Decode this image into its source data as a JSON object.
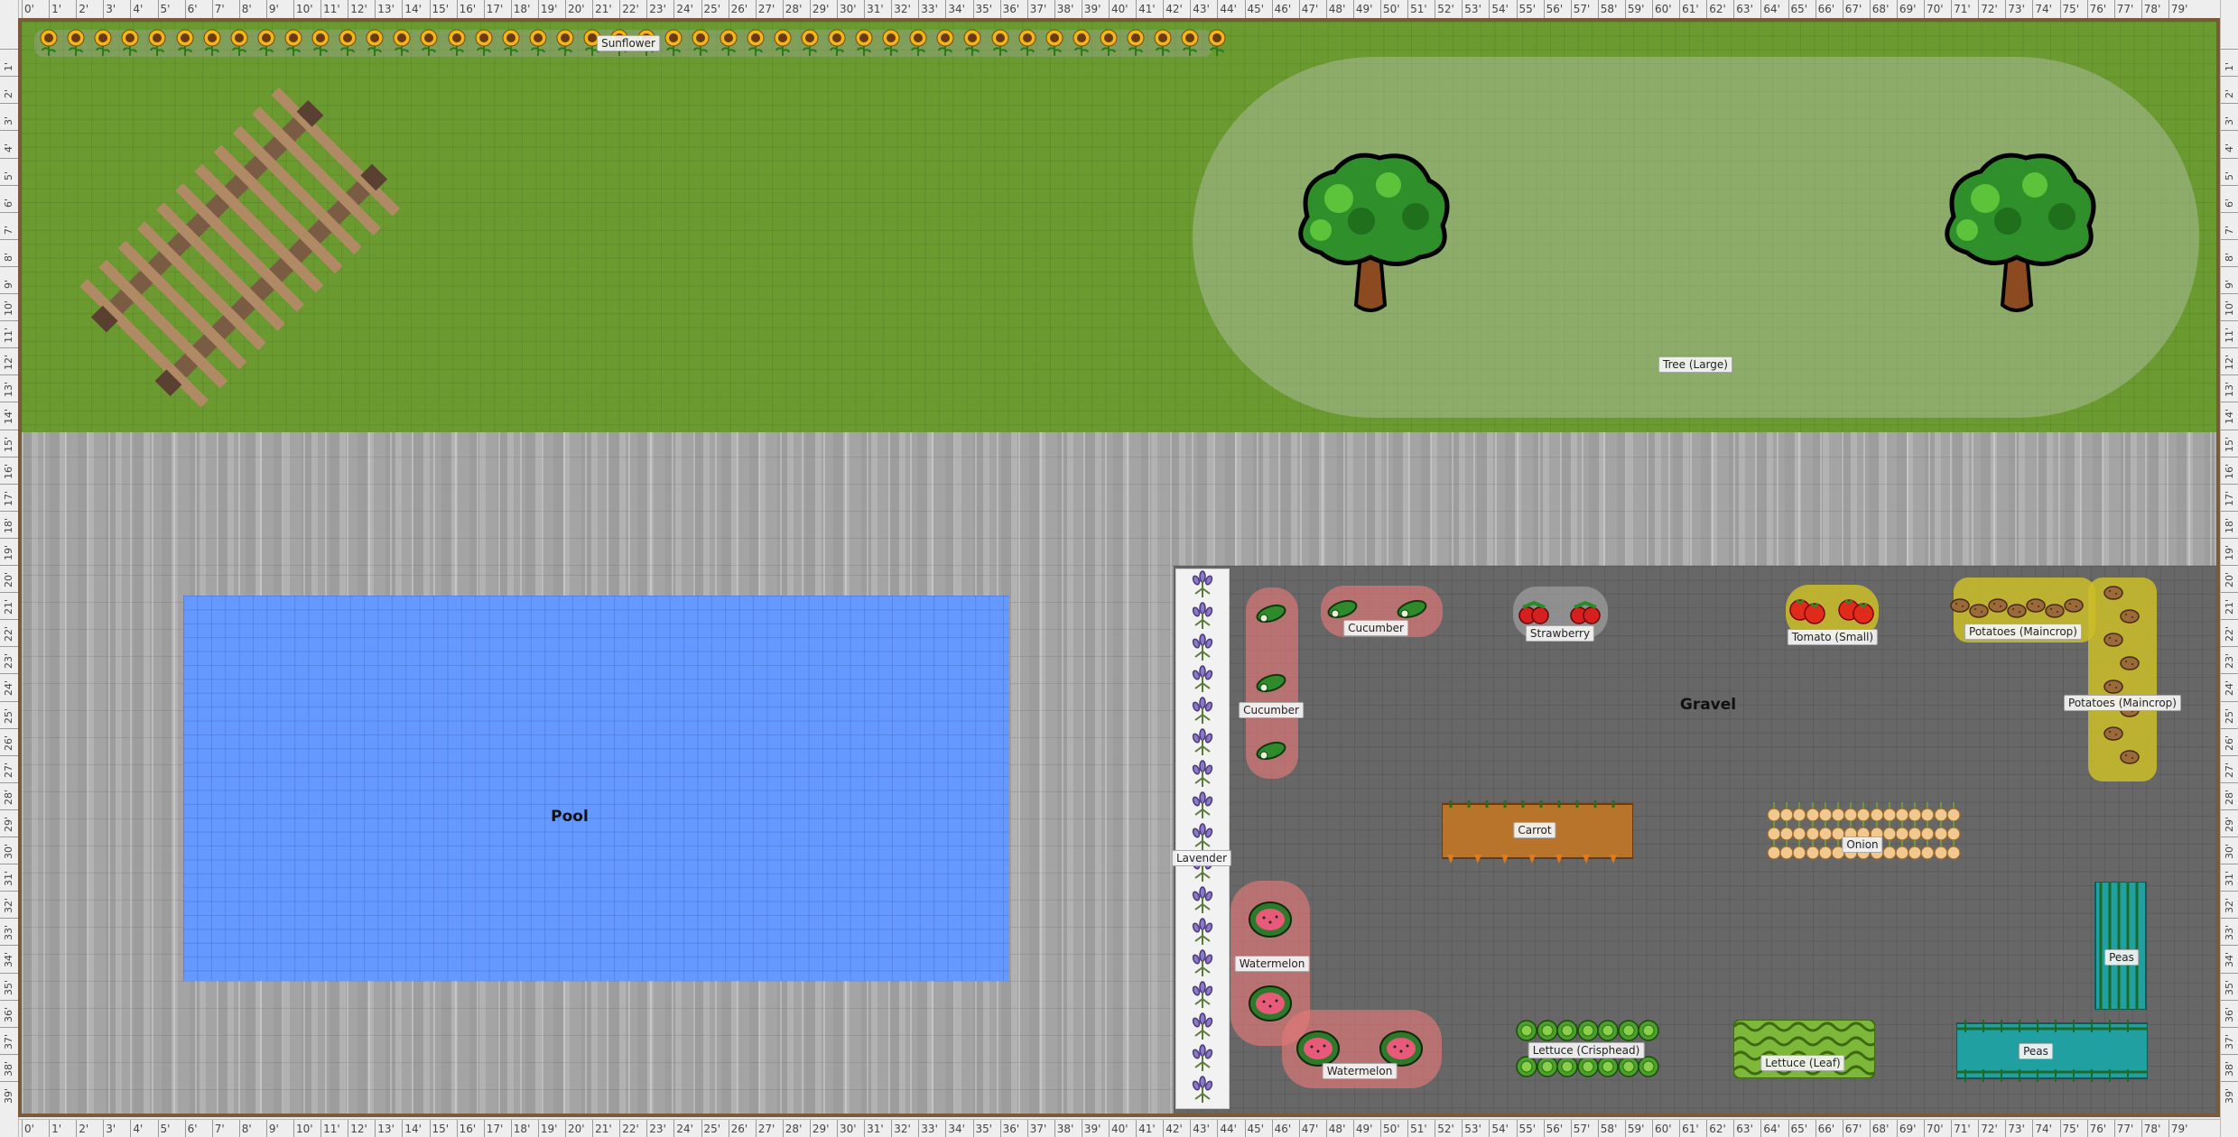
{
  "ruler": {
    "ticks": [
      "0'",
      "1'",
      "2'",
      "3'",
      "4'",
      "5'",
      "6'",
      "7'",
      "8'",
      "9'",
      "10'",
      "11'",
      "12'",
      "13'",
      "14'",
      "15'",
      "16'",
      "17'",
      "18'",
      "19'",
      "20'",
      "21'",
      "22'",
      "23'",
      "24'",
      "25'",
      "26'",
      "27'",
      "28'",
      "29'",
      "30'",
      "31'",
      "32'",
      "33'",
      "34'",
      "35'",
      "36'",
      "37'",
      "38'",
      "39'",
      "40'",
      "41'",
      "42'",
      "43'",
      "44'",
      "45'",
      "46'",
      "47'",
      "48'",
      "49'",
      "50'",
      "51'",
      "52'",
      "53'",
      "54'",
      "55'",
      "56'",
      "57'",
      "58'",
      "59'",
      "60'",
      "61'",
      "62'",
      "63'",
      "64'",
      "65'",
      "66'",
      "67'",
      "68'",
      "69'",
      "70'",
      "71'",
      "72'",
      "73'",
      "74'",
      "75'",
      "76'",
      "77'",
      "78'",
      "79'"
    ],
    "vticks": [
      "1'",
      "2'",
      "3'",
      "4'",
      "5'",
      "6'",
      "7'",
      "8'",
      "9'",
      "10'",
      "11'",
      "12'",
      "13'",
      "14'",
      "15'",
      "16'",
      "17'",
      "18'",
      "19'",
      "20'",
      "21'",
      "22'",
      "23'",
      "24'",
      "25'",
      "26'",
      "27'",
      "28'",
      "29'",
      "30'",
      "31'",
      "32'",
      "33'",
      "34'",
      "35'",
      "36'",
      "37'",
      "38'",
      "39'"
    ]
  },
  "areas": {
    "pool": "Pool",
    "gravel": "Gravel"
  },
  "labels": {
    "sunflower": "Sunflower",
    "tree": "Tree (Large)",
    "lavender": "Lavender",
    "cucumber_v": "Cucumber",
    "cucumber_h": "Cucumber",
    "strawberry": "Strawberry",
    "tomato": "Tomato (Small)",
    "potatoes_h": "Potatoes (Maincrop)",
    "potatoes_v": "Potatoes (Maincrop)",
    "carrot": "Carrot",
    "onion": "Onion",
    "watermelon_v": "Watermelon",
    "watermelon_h": "Watermelon",
    "peas_v": "Peas",
    "peas_h": "Peas",
    "lettuce_crisp": "Lettuce (Crisphead)",
    "lettuce_leaf": "Lettuce (Leaf)"
  },
  "colors": {
    "grass": "#6a9a30",
    "gravel": "#676767",
    "pool": "#6699ff",
    "paving": "#a7a7a7",
    "border": "#7a5a3a"
  }
}
